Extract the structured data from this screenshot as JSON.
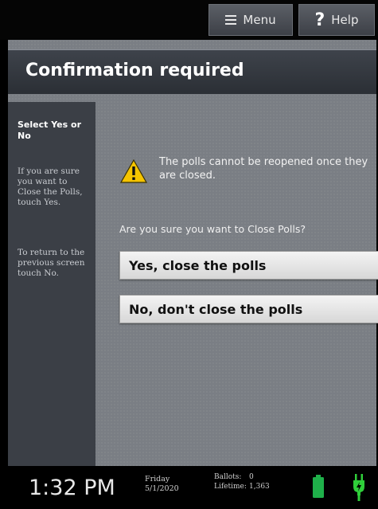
{
  "topbar": {
    "menu_label": "Menu",
    "help_label": "Help",
    "help_glyph": "?"
  },
  "screen": {
    "title": "Confirmation required",
    "sidebar": {
      "heading": "Select Yes or No",
      "instruction_1": "If you are sure you want to Close the Polls, touch Yes.",
      "instruction_2": "To return to the previous screen touch No."
    },
    "warning_icon": "warning-triangle-icon",
    "warning_text": "The polls cannot be reopened once they are closed.",
    "question": "Are you sure you want to Close Polls?",
    "yes_label": "Yes, close the polls",
    "no_label": "No, don't close the polls"
  },
  "status": {
    "time": "1:32 PM",
    "day": "Friday",
    "date": "5/1/2020",
    "ballots_label": "Ballots:",
    "ballots_value": "0",
    "lifetime_label": "Lifetime:",
    "lifetime_value": "1,363",
    "battery_icon": "battery-icon",
    "plug_icon": "power-plug-icon"
  },
  "colors": {
    "battery_green": "#1fb04a",
    "warning_yellow": "#f5c400"
  }
}
